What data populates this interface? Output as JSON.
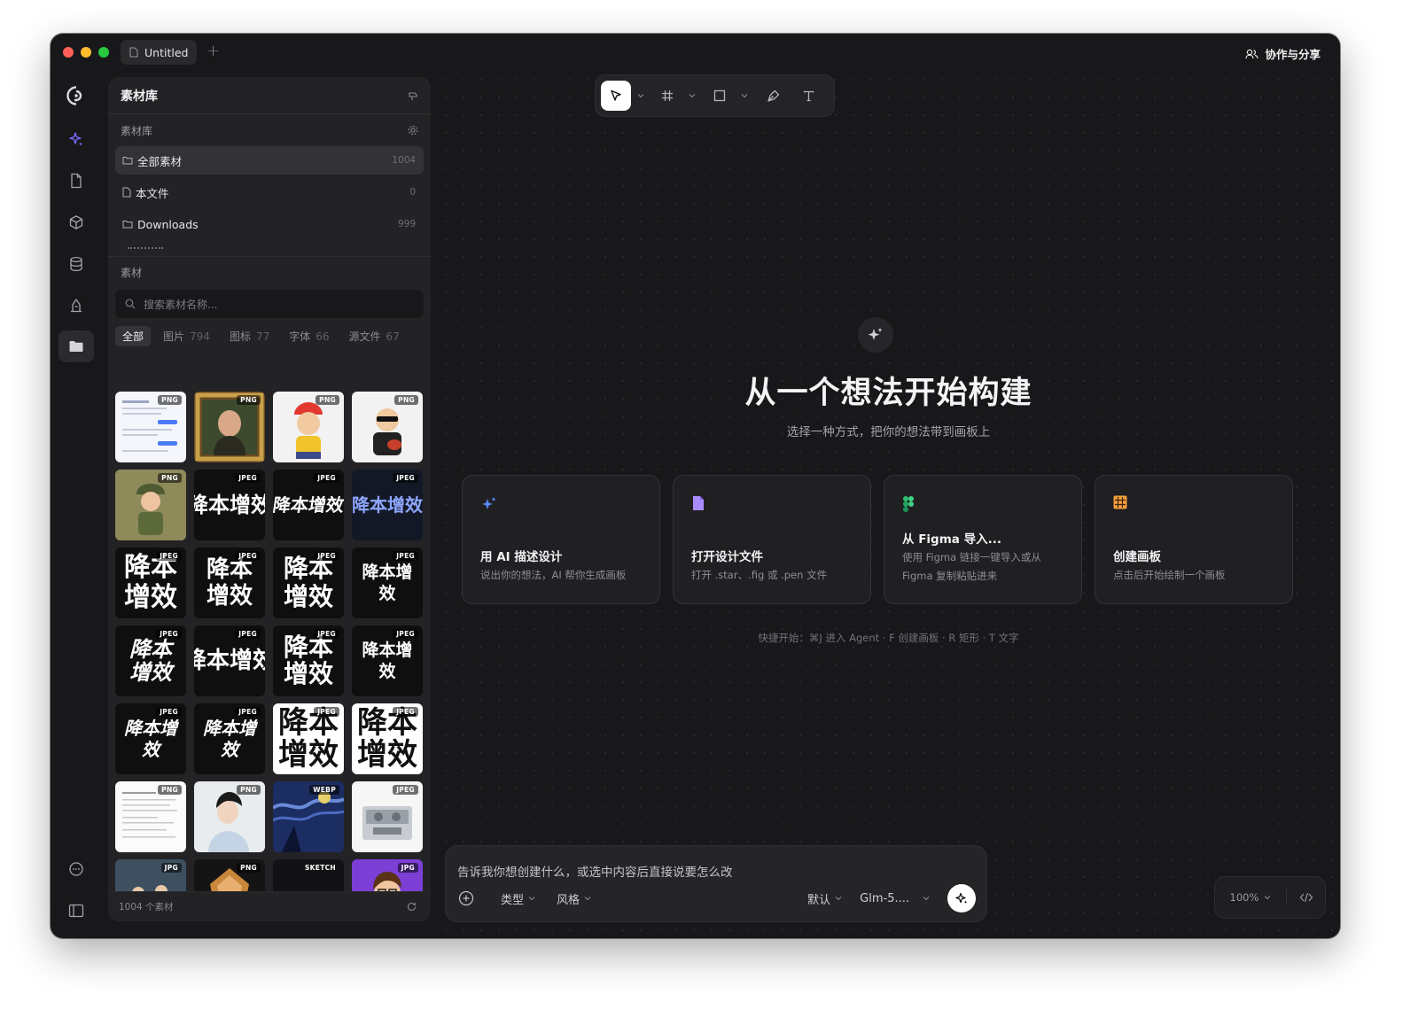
{
  "window": {
    "tab_title": "Untitled",
    "share_label": "协作与分享"
  },
  "rail": {
    "items": [
      "logo-icon",
      "ai-sparkle-icon",
      "file-icon",
      "cube-icon",
      "database-icon",
      "brush-icon",
      "folder-icon"
    ],
    "bottom": [
      "feedback-icon",
      "layout-icon"
    ],
    "accent": "#7b6cff"
  },
  "library": {
    "title": "素材库",
    "section_label": "素材库",
    "folders": [
      {
        "name": "全部素材",
        "count": "1004"
      },
      {
        "name": "本文件",
        "count": "0"
      },
      {
        "name": "Downloads",
        "count": "999"
      }
    ],
    "assets_label": "素材",
    "search_placeholder": "搜索素材名称...",
    "filters": [
      {
        "label": "全部",
        "count": ""
      },
      {
        "label": "图片",
        "count": "794"
      },
      {
        "label": "图标",
        "count": "77"
      },
      {
        "label": "字体",
        "count": "66"
      },
      {
        "label": "源文件",
        "count": "67"
      }
    ],
    "thumbs": [
      {
        "tag": "PNG"
      },
      {
        "tag": "PNG"
      },
      {
        "tag": "PNG"
      },
      {
        "tag": "PNG"
      },
      {
        "tag": "PNG"
      },
      {
        "tag": "JPEG",
        "text": "降本增效"
      },
      {
        "tag": "JPEG",
        "text": "降本增效"
      },
      {
        "tag": "JPEG",
        "text": "降本增效"
      },
      {
        "tag": "JPEG",
        "text": "降本增效"
      },
      {
        "tag": "JPEG",
        "text": "降本增效"
      },
      {
        "tag": "JPEG",
        "text": "降本增效"
      },
      {
        "tag": "JPEG",
        "text": "降本增效"
      },
      {
        "tag": "JPEG",
        "text": "降本增效"
      },
      {
        "tag": "JPEG",
        "text": "降本增效"
      },
      {
        "tag": "JPEG",
        "text": "降本增效"
      },
      {
        "tag": "JPEG",
        "text": "降本增效"
      },
      {
        "tag": "JPEG",
        "text": "降本增效"
      },
      {
        "tag": "JPEG",
        "text": "降本增效"
      },
      {
        "tag": "JPEG",
        "text": "降本增效"
      },
      {
        "tag": "JPEG",
        "text": "降本增效"
      },
      {
        "tag": "PNG"
      },
      {
        "tag": "PNG"
      },
      {
        "tag": "WEBP"
      },
      {
        "tag": "JPEG"
      },
      {
        "tag": "JPG"
      },
      {
        "tag": "PNG"
      },
      {
        "tag": "SKETCH"
      },
      {
        "tag": "JPG"
      }
    ],
    "footer_count": "1004 个素材"
  },
  "toolbar": {
    "tools": [
      "select-icon",
      "frame-icon",
      "rectangle-icon",
      "pen-icon",
      "text-icon"
    ]
  },
  "hero": {
    "title": "从一个想法开始构建",
    "subtitle": "选择一种方式，把你的想法带到画板上"
  },
  "cards": [
    {
      "title": "用 AI 描述设计",
      "desc": "说出你的想法，AI 帮你生成画板",
      "icon": "ai-sparkle-icon",
      "color": "#5b8cff"
    },
    {
      "title": "打开设计文件",
      "desc": "打开 .star、.fig 或 .pen 文件",
      "icon": "file-icon",
      "color": "#a78bfa"
    },
    {
      "title": "从 Figma 导入...",
      "desc": "使用 Figma 链接一键导入或从 Figma 复制粘贴进来",
      "icon": "figma-icon",
      "color": "#2fbf71"
    },
    {
      "title": "创建画板",
      "desc": "点击后开始绘制一个画板",
      "icon": "grid-icon",
      "color": "#f59e3a"
    }
  ],
  "hint": "快捷开始：⌘J 进入 Agent · F 创建画板 · R 矩形 · T 文字",
  "composer": {
    "placeholder": "告诉我你想创建什么，或选中内容后直接说要怎么改",
    "type_label": "类型",
    "style_label": "风格",
    "default_label": "默认",
    "model_label": "Glm-5...."
  },
  "zoom": {
    "level": "100%"
  }
}
